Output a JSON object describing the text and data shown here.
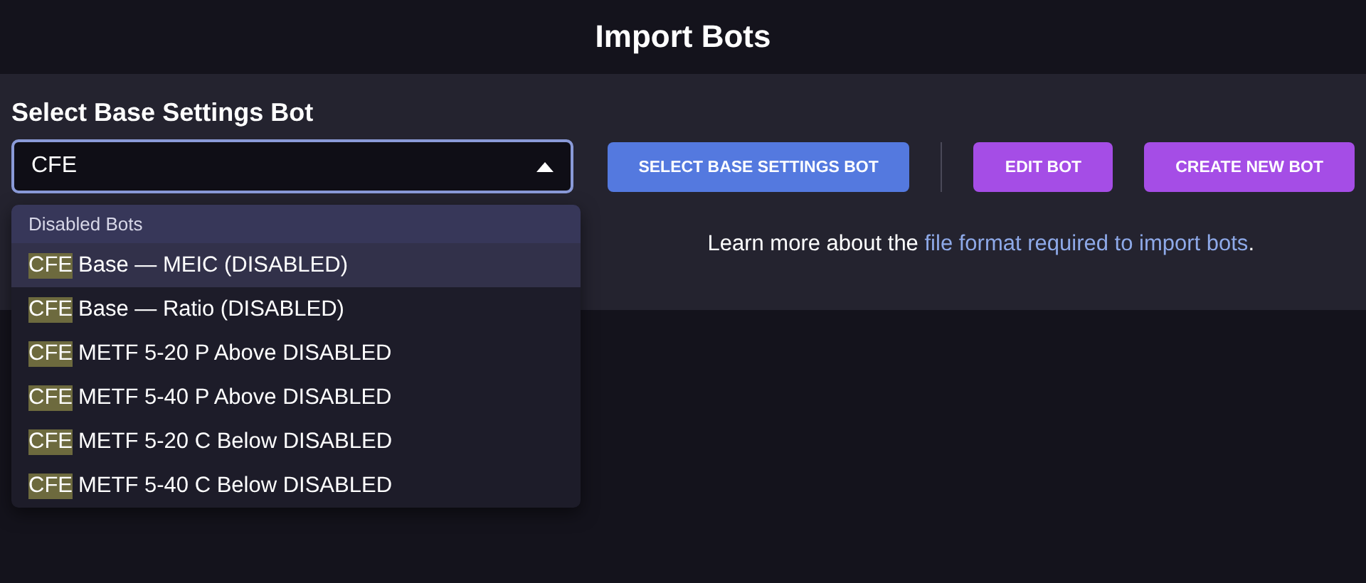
{
  "title": "Import Bots",
  "section_label": "Select Base Settings Bot",
  "select": {
    "value": "CFE",
    "expanded": true
  },
  "dropdown": {
    "group": "Disabled Bots",
    "options": [
      {
        "match": "CFE",
        "rest": " Base — MEIC (DISABLED)",
        "selected": true
      },
      {
        "match": "CFE",
        "rest": " Base — Ratio (DISABLED)",
        "selected": false
      },
      {
        "match": "CFE",
        "rest": " METF 5-20 P Above DISABLED",
        "selected": false
      },
      {
        "match": "CFE",
        "rest": " METF 5-40 P Above DISABLED",
        "selected": false
      },
      {
        "match": "CFE",
        "rest": " METF 5-20 C Below DISABLED",
        "selected": false
      },
      {
        "match": "CFE",
        "rest": " METF 5-40 C Below DISABLED",
        "selected": false
      }
    ]
  },
  "buttons": [
    {
      "label": "SELECT BASE SETTINGS BOT",
      "kind": "primary"
    },
    {
      "kind": "divider"
    },
    {
      "label": "EDIT BOT",
      "kind": "accent"
    },
    {
      "label": "CREATE NEW BOT",
      "kind": "accent"
    }
  ],
  "info": {
    "before": "Learn more about the ",
    "link": "file format required to import bots",
    "after": "."
  }
}
